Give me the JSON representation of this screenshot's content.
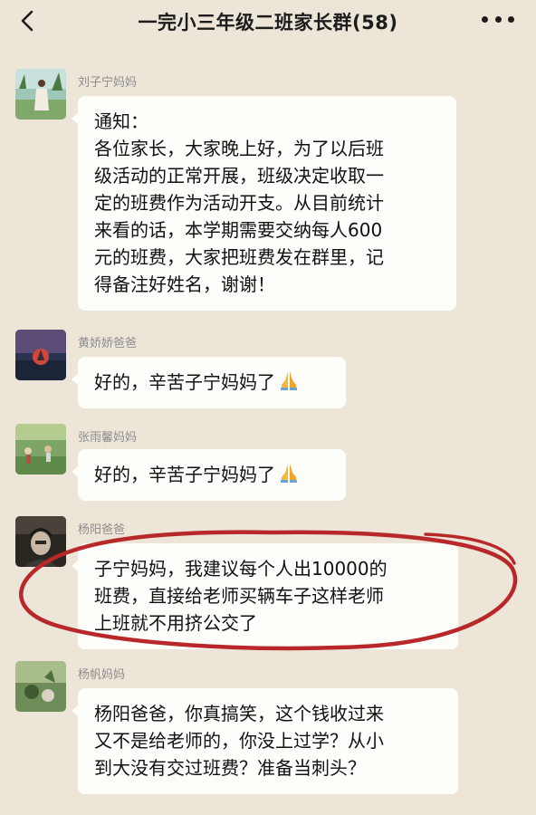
{
  "header": {
    "title": "一完小三年级二班家长群(58)",
    "back_icon": "chevron-left-icon",
    "more_icon": "more-dots-icon"
  },
  "messages": [
    {
      "sender": "刘子宁妈妈",
      "lines": [
        "通知：",
        "各位家长，大家晚上好，为了以后班",
        "级活动的正常开展，班级决定收取一",
        "定的班费作为活动开支。从目前统计",
        "来看的话，本学期需要交纳每人600",
        "元的班费，大家把班费发在群里，记",
        "得备注好姓名，谢谢！"
      ]
    },
    {
      "sender": "黄娇娇爸爸",
      "lines": [
        "好的，辛苦子宁妈妈了"
      ],
      "emoji": "folded-hands-icon"
    },
    {
      "sender": "张雨馨妈妈",
      "lines": [
        "好的，辛苦子宁妈妈了"
      ],
      "emoji": "folded-hands-icon"
    },
    {
      "sender": "杨阳爸爸",
      "lines": [
        "子宁妈妈，我建议每个人出10000的",
        "班费，直接给老师买辆车子这样老师",
        "上班就不用挤公交了"
      ]
    },
    {
      "sender": "杨帆妈妈",
      "lines": [
        "杨阳爸爸，你真搞笑，这个钱收过来",
        "又不是给老师的，你没上过学？从小",
        "到大没有交过班费？准备当刺头？"
      ]
    }
  ],
  "colors": {
    "background": "#ece5d8",
    "bubble": "#fdfdfa",
    "sender_name": "#8d8d8d",
    "annotation_circle": "#b8282a"
  }
}
